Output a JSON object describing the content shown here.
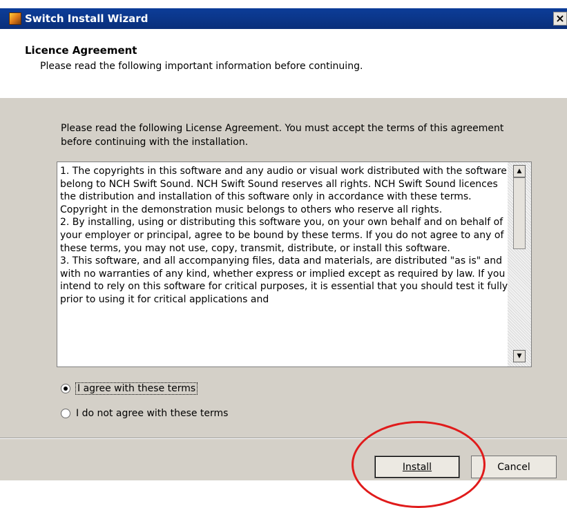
{
  "window": {
    "title": "Switch Install Wizard",
    "close_glyph": "×"
  },
  "header": {
    "title": "Licence Agreement",
    "subtitle": "Please read the following important information before continuing."
  },
  "intro": "Please read the following License Agreement. You must accept the terms of this agreement before continuing with the installation.",
  "license": {
    "text": "1. The copyrights in this software and any audio or visual work distributed with the software belong to NCH Swift Sound. NCH Swift Sound reserves all rights. NCH Swift Sound licences the distribution and installation of this software only in accordance with these terms. Copyright in the demonstration music belongs to others who reserve all rights.\n2. By installing, using or distributing this software you, on your own behalf and on behalf of your employer or principal, agree to be bound by these terms. If you do not agree to any of these terms, you may not use, copy, transmit, distribute, or install this software.\n3. This software, and all accompanying files, data and materials, are distributed \"as is\" and with no warranties of any kind, whether express or implied except as required by law. If you intend to rely on this software for critical purposes, it is essential that you should test it fully prior to using it for critical applications and"
  },
  "options": [
    {
      "label": "I agree with these terms",
      "selected": true
    },
    {
      "label": "I do not agree with these terms",
      "selected": false
    }
  ],
  "buttons": {
    "install": "Install",
    "cancel": "Cancel"
  },
  "icons": {
    "app": "switch-app-icon",
    "close": "close-icon",
    "scroll_up": "scroll-up-arrow-icon",
    "scroll_down": "scroll-down-arrow-icon"
  },
  "colors": {
    "titlebar": "#0c3d99",
    "dialog_bg": "#d4d0c8",
    "annotation": "#e01b1b"
  }
}
